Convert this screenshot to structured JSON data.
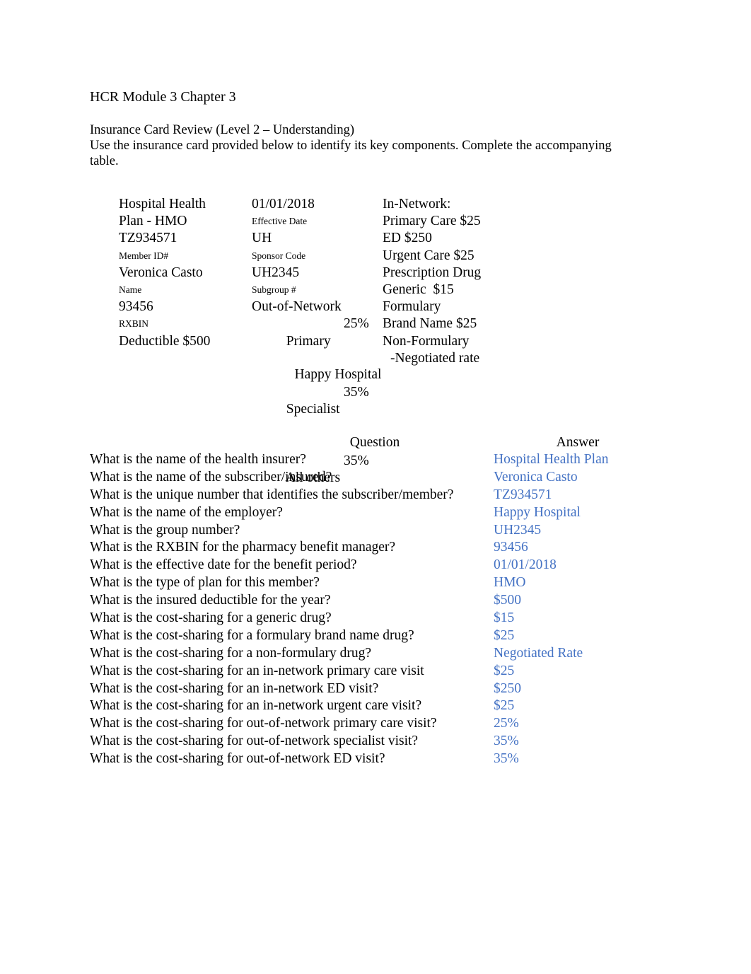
{
  "document": {
    "title": "HCR Module 3 Chapter 3",
    "intro_heading": "Insurance Card Review (Level 2 – Understanding)",
    "intro_body": "Use the insurance card provided below to identify its key components.  Complete the accompanying table."
  },
  "insurance_card": {
    "left_column": {
      "plan_name_line1": "Hospital Health",
      "plan_name_line2": "Plan - HMO",
      "member_id_value": "TZ934571",
      "member_id_label": "Member ID#",
      "name_value": "Veronica Casto",
      "name_label": "Name",
      "rxbin_value": "93456",
      "rxbin_label": "RXBIN",
      "deductible": "Deductible $500"
    },
    "middle_column": {
      "effective_date_value": "01/01/2018",
      "effective_date_label": "Effective Date",
      "sponsor_code_value": "UH",
      "sponsor_code_label": "Sponsor Code",
      "subgroup_value": "UH2345",
      "subgroup_label": "Subgroup #",
      "out_of_network_heading": "Out-of-Network",
      "rows": [
        {
          "label": "Primary",
          "value": "25%"
        },
        {
          "label": "Specialist",
          "value": "35%"
        },
        {
          "label": "All others",
          "value": "35%"
        }
      ]
    },
    "right_column": {
      "in_network_heading": "In-Network:",
      "primary_care": "Primary Care $25",
      "ed": "ED $250",
      "urgent_care": "Urgent Care $25",
      "prescription_drug_heading": "Prescription Drug",
      "generic": "Generic  $15",
      "formulary": "Formulary",
      "brand_name": "Brand Name $25",
      "non_formulary": "Non-Formulary",
      "negotiated_rate": "-Negotiated rate"
    },
    "employer": "Happy Hospital"
  },
  "qa_table": {
    "header_question": "Question",
    "header_answer": "Answer",
    "answer_color": "#4472C4",
    "rows": [
      {
        "question": "What is the name of the health insurer?",
        "answer": "Hospital Health Plan"
      },
      {
        "question": "What is the name of the subscriber/insured?",
        "answer": "Veronica Casto"
      },
      {
        "question": "What is the unique number that identifies the subscriber/member?",
        "answer": "TZ934571"
      },
      {
        "question": "What is the name of the employer?",
        "answer": "Happy Hospital"
      },
      {
        "question": "What is the group number?",
        "answer": "UH2345"
      },
      {
        "question": "What is the RXBIN for the pharmacy benefit manager?",
        "answer": "93456"
      },
      {
        "question": "What is the effective date for the benefit period?",
        "answer": "01/01/2018"
      },
      {
        "question": "What is the type of plan for this member?",
        "answer": "HMO"
      },
      {
        "question": "What is the insured deductible for the year?",
        "answer": "$500"
      },
      {
        "question": "What is the cost-sharing for a generic drug?",
        "answer": "$15"
      },
      {
        "question": "What is the cost-sharing for a formulary brand name drug?",
        "answer": "$25"
      },
      {
        "question": "What is the cost-sharing for a non-formulary drug?",
        "answer": "Negotiated Rate"
      },
      {
        "question": "What is the cost-sharing for an in-network primary care visit",
        "answer": "$25"
      },
      {
        "question": "What is the cost-sharing for an in-network ED visit?",
        "answer": "$250"
      },
      {
        "question": "What is the cost-sharing for an in-network urgent care visit?",
        "answer": "$25"
      },
      {
        "question": "What is the cost-sharing for out-of-network primary care visit?",
        "answer": "25%"
      },
      {
        "question": "What is the cost-sharing for out-of-network specialist visit?",
        "answer": "35%"
      },
      {
        "question": "What is the cost-sharing for out-of-network ED visit?",
        "answer": "35%"
      }
    ]
  }
}
